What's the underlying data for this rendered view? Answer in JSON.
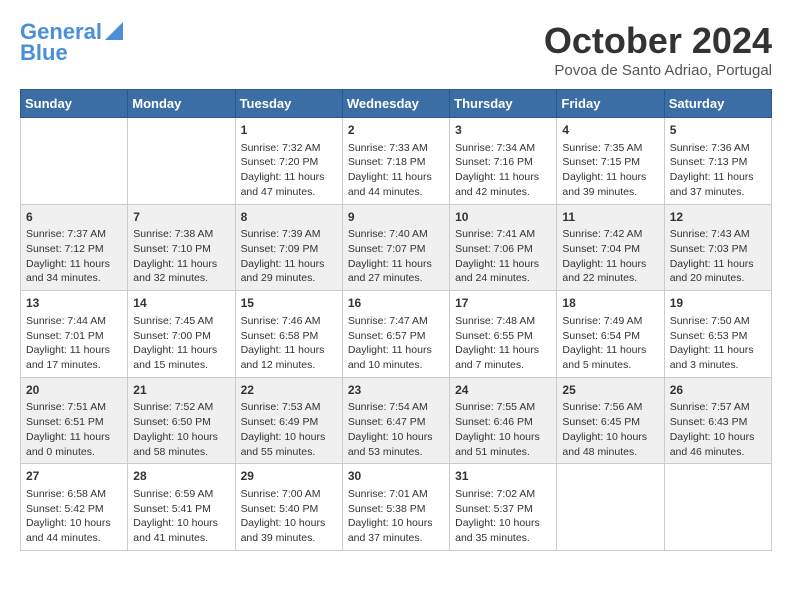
{
  "header": {
    "logo_line1": "General",
    "logo_line2": "Blue",
    "month_title": "October 2024",
    "location": "Povoa de Santo Adriao, Portugal"
  },
  "weekdays": [
    "Sunday",
    "Monday",
    "Tuesday",
    "Wednesday",
    "Thursday",
    "Friday",
    "Saturday"
  ],
  "weeks": [
    [
      {
        "day": "",
        "content": ""
      },
      {
        "day": "",
        "content": ""
      },
      {
        "day": "1",
        "content": "Sunrise: 7:32 AM\nSunset: 7:20 PM\nDaylight: 11 hours and 47 minutes."
      },
      {
        "day": "2",
        "content": "Sunrise: 7:33 AM\nSunset: 7:18 PM\nDaylight: 11 hours and 44 minutes."
      },
      {
        "day": "3",
        "content": "Sunrise: 7:34 AM\nSunset: 7:16 PM\nDaylight: 11 hours and 42 minutes."
      },
      {
        "day": "4",
        "content": "Sunrise: 7:35 AM\nSunset: 7:15 PM\nDaylight: 11 hours and 39 minutes."
      },
      {
        "day": "5",
        "content": "Sunrise: 7:36 AM\nSunset: 7:13 PM\nDaylight: 11 hours and 37 minutes."
      }
    ],
    [
      {
        "day": "6",
        "content": "Sunrise: 7:37 AM\nSunset: 7:12 PM\nDaylight: 11 hours and 34 minutes."
      },
      {
        "day": "7",
        "content": "Sunrise: 7:38 AM\nSunset: 7:10 PM\nDaylight: 11 hours and 32 minutes."
      },
      {
        "day": "8",
        "content": "Sunrise: 7:39 AM\nSunset: 7:09 PM\nDaylight: 11 hours and 29 minutes."
      },
      {
        "day": "9",
        "content": "Sunrise: 7:40 AM\nSunset: 7:07 PM\nDaylight: 11 hours and 27 minutes."
      },
      {
        "day": "10",
        "content": "Sunrise: 7:41 AM\nSunset: 7:06 PM\nDaylight: 11 hours and 24 minutes."
      },
      {
        "day": "11",
        "content": "Sunrise: 7:42 AM\nSunset: 7:04 PM\nDaylight: 11 hours and 22 minutes."
      },
      {
        "day": "12",
        "content": "Sunrise: 7:43 AM\nSunset: 7:03 PM\nDaylight: 11 hours and 20 minutes."
      }
    ],
    [
      {
        "day": "13",
        "content": "Sunrise: 7:44 AM\nSunset: 7:01 PM\nDaylight: 11 hours and 17 minutes."
      },
      {
        "day": "14",
        "content": "Sunrise: 7:45 AM\nSunset: 7:00 PM\nDaylight: 11 hours and 15 minutes."
      },
      {
        "day": "15",
        "content": "Sunrise: 7:46 AM\nSunset: 6:58 PM\nDaylight: 11 hours and 12 minutes."
      },
      {
        "day": "16",
        "content": "Sunrise: 7:47 AM\nSunset: 6:57 PM\nDaylight: 11 hours and 10 minutes."
      },
      {
        "day": "17",
        "content": "Sunrise: 7:48 AM\nSunset: 6:55 PM\nDaylight: 11 hours and 7 minutes."
      },
      {
        "day": "18",
        "content": "Sunrise: 7:49 AM\nSunset: 6:54 PM\nDaylight: 11 hours and 5 minutes."
      },
      {
        "day": "19",
        "content": "Sunrise: 7:50 AM\nSunset: 6:53 PM\nDaylight: 11 hours and 3 minutes."
      }
    ],
    [
      {
        "day": "20",
        "content": "Sunrise: 7:51 AM\nSunset: 6:51 PM\nDaylight: 11 hours and 0 minutes."
      },
      {
        "day": "21",
        "content": "Sunrise: 7:52 AM\nSunset: 6:50 PM\nDaylight: 10 hours and 58 minutes."
      },
      {
        "day": "22",
        "content": "Sunrise: 7:53 AM\nSunset: 6:49 PM\nDaylight: 10 hours and 55 minutes."
      },
      {
        "day": "23",
        "content": "Sunrise: 7:54 AM\nSunset: 6:47 PM\nDaylight: 10 hours and 53 minutes."
      },
      {
        "day": "24",
        "content": "Sunrise: 7:55 AM\nSunset: 6:46 PM\nDaylight: 10 hours and 51 minutes."
      },
      {
        "day": "25",
        "content": "Sunrise: 7:56 AM\nSunset: 6:45 PM\nDaylight: 10 hours and 48 minutes."
      },
      {
        "day": "26",
        "content": "Sunrise: 7:57 AM\nSunset: 6:43 PM\nDaylight: 10 hours and 46 minutes."
      }
    ],
    [
      {
        "day": "27",
        "content": "Sunrise: 6:58 AM\nSunset: 5:42 PM\nDaylight: 10 hours and 44 minutes."
      },
      {
        "day": "28",
        "content": "Sunrise: 6:59 AM\nSunset: 5:41 PM\nDaylight: 10 hours and 41 minutes."
      },
      {
        "day": "29",
        "content": "Sunrise: 7:00 AM\nSunset: 5:40 PM\nDaylight: 10 hours and 39 minutes."
      },
      {
        "day": "30",
        "content": "Sunrise: 7:01 AM\nSunset: 5:38 PM\nDaylight: 10 hours and 37 minutes."
      },
      {
        "day": "31",
        "content": "Sunrise: 7:02 AM\nSunset: 5:37 PM\nDaylight: 10 hours and 35 minutes."
      },
      {
        "day": "",
        "content": ""
      },
      {
        "day": "",
        "content": ""
      }
    ]
  ]
}
